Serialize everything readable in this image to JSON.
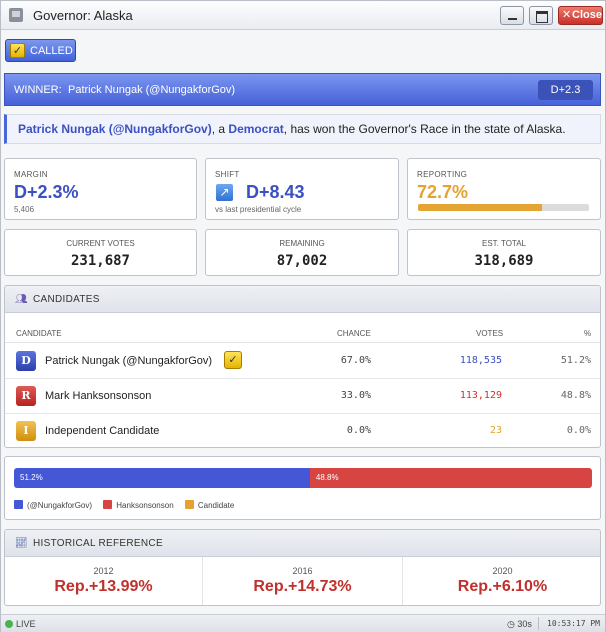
{
  "window": {
    "title": "Governor: Alaska",
    "close_label": "Close",
    "close_glyph": "✕"
  },
  "called_badge": {
    "label": "CALLED",
    "icon": "checkmark-icon"
  },
  "winner": {
    "label": "WINNER:",
    "name": "Patrick Nungak (@NungakforGov)",
    "badge": "D+2.3"
  },
  "description": {
    "candidate": "Patrick Nungak (@NungakforGov)",
    "part1": ", a ",
    "party": "Democrat",
    "part2": ", has won the Governor's Race in the state of Alaska."
  },
  "stats": {
    "margin": {
      "caption": "MARGIN",
      "value": "D+2.3%",
      "sub": "5,406"
    },
    "shift": {
      "caption": "SHIFT",
      "value": "D+8.43",
      "sub": "vs last presidential cycle",
      "icon": "arrow-up-right-icon"
    },
    "reporting": {
      "caption": "REPORTING",
      "value": "72.7%",
      "progress_fraction": 0.727
    },
    "current_votes": {
      "caption": "CURRENT VOTES",
      "value": "231,687"
    },
    "remaining": {
      "caption": "REMAINING",
      "value": "87,002"
    },
    "est_total": {
      "caption": "EST. TOTAL",
      "value": "318,689"
    }
  },
  "candidates": {
    "title": "CANDIDATES",
    "icon": "people-icon",
    "columns": {
      "candidate": "CANDIDATE",
      "chance": "CHANCE",
      "votes": "VOTES",
      "pct": "%"
    },
    "rows": [
      {
        "party": "D",
        "name": "Patrick Nungak (@NungakforGov)",
        "winner": true,
        "chance": "67.0%",
        "votes": "118,535",
        "pct": "51.2%",
        "color": "#3b50c2"
      },
      {
        "party": "R",
        "name": "Mark Hanksonsonson",
        "winner": false,
        "chance": "33.0%",
        "votes": "113,129",
        "pct": "48.8%",
        "color": "#d0302d"
      },
      {
        "party": "I",
        "name": "Independent Candidate",
        "winner": false,
        "chance": "0.0%",
        "votes": "23",
        "pct": "0.0%",
        "color": "#e5a22e"
      }
    ]
  },
  "vote_bar": {
    "segments": [
      {
        "label": "51.2%",
        "share": 51.2,
        "color": "#4457d6"
      },
      {
        "label": "48.8%",
        "share": 48.8,
        "color": "#d64541"
      },
      {
        "label": "",
        "share": 0.0,
        "color": "#e5a22e"
      }
    ],
    "legend": [
      {
        "label": "(@NungakforGov)",
        "color": "#4457d6"
      },
      {
        "label": "Hanksonsonson",
        "color": "#d64541"
      },
      {
        "label": "Candidate",
        "color": "#e5a22e"
      }
    ]
  },
  "historical": {
    "title": "HISTORICAL REFERENCE",
    "icon": "trend-chart-icon",
    "items": [
      {
        "year": "2012",
        "value": "Rep.+13.99%"
      },
      {
        "year": "2016",
        "value": "Rep.+14.73%"
      },
      {
        "year": "2020",
        "value": "Rep.+6.10%"
      }
    ]
  },
  "status": {
    "live": "LIVE",
    "timer": "30s",
    "timer_icon": "clock-icon",
    "clock": "10:53:17 PM"
  },
  "colors": {
    "dem": "#3b50c2",
    "rep": "#d0302d",
    "ind": "#e5a22e"
  }
}
